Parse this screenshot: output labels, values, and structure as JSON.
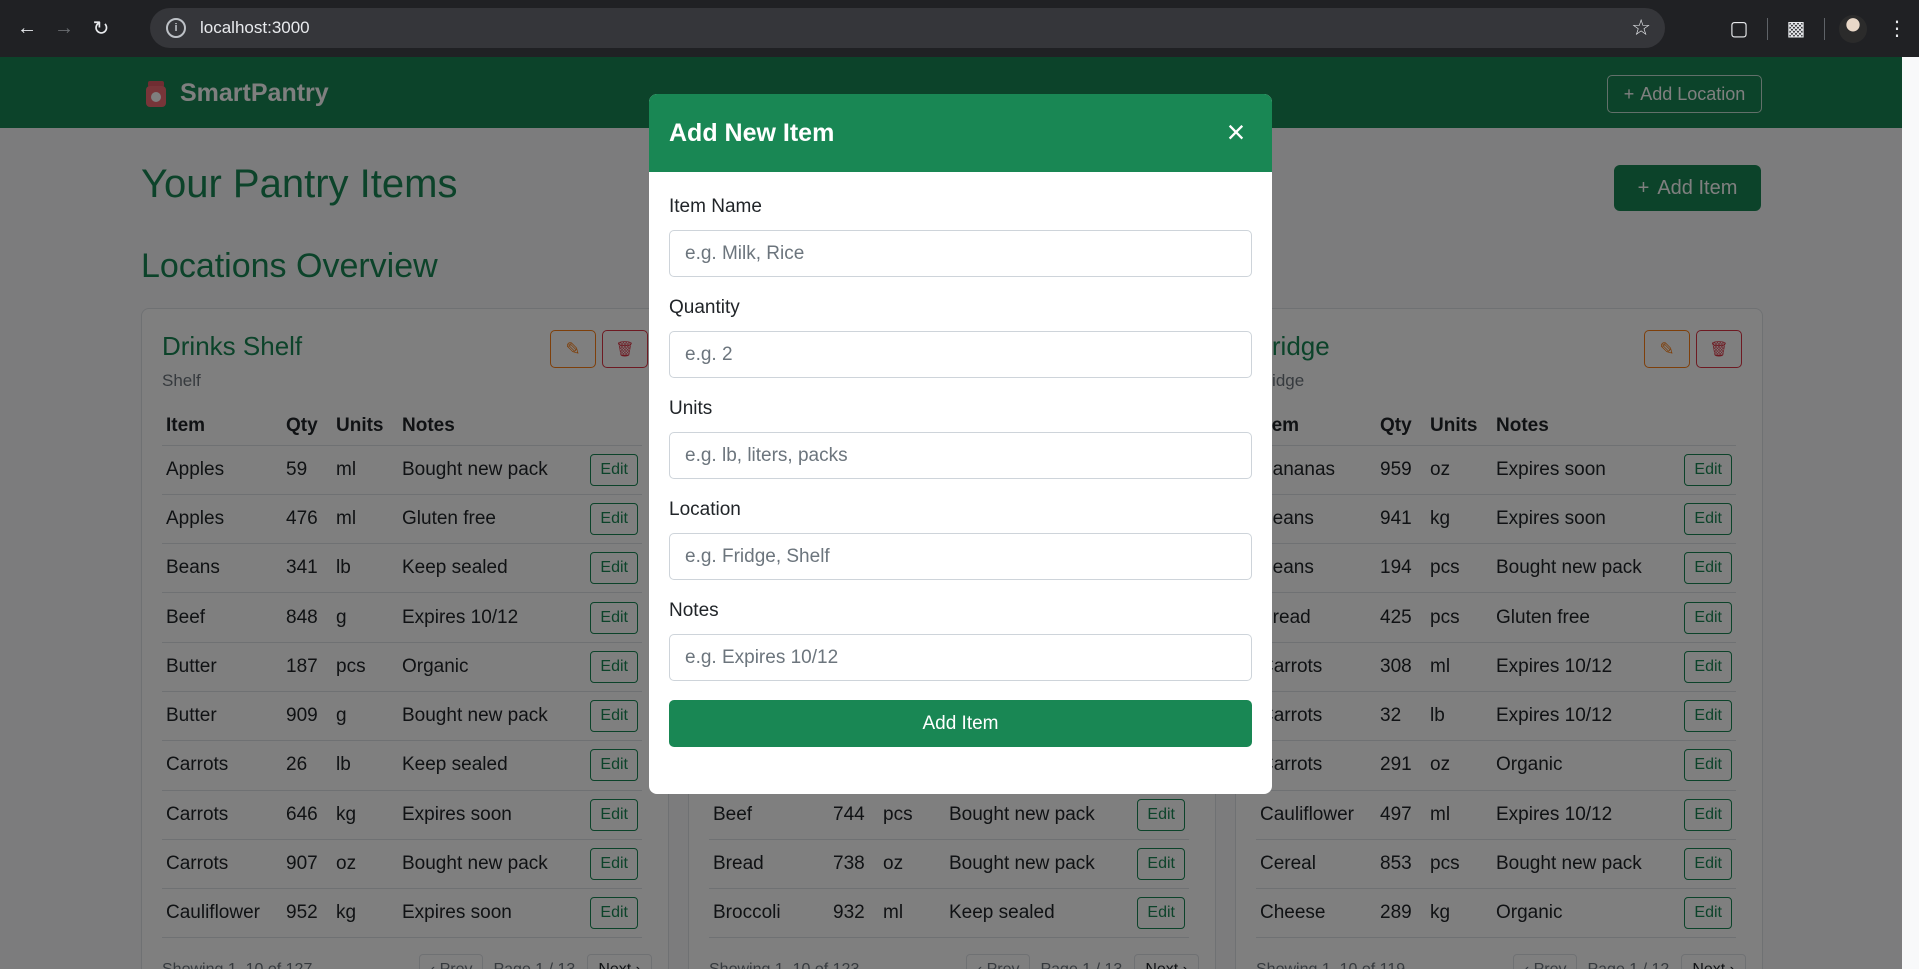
{
  "browser": {
    "url": "localhost:3000"
  },
  "navbar": {
    "brand": "SmartPantry",
    "add_location_label": "Add Location"
  },
  "main": {
    "title": "Your Pantry Items",
    "add_item_label": "Add Item",
    "locations_title": "Locations Overview"
  },
  "table_headers": [
    "Item",
    "Qty",
    "Units",
    "Notes"
  ],
  "edit_label": "Edit",
  "pager": {
    "prev": "‹ Prev",
    "next": "Next ›"
  },
  "locations": [
    {
      "name": "Drinks Shelf",
      "type": "Shelf",
      "showing": "Showing 1–10 of 127",
      "page": "Page 1 / 13",
      "rows": [
        [
          "Apples",
          "59",
          "ml",
          "Bought new pack"
        ],
        [
          "Apples",
          "476",
          "ml",
          "Gluten free"
        ],
        [
          "Beans",
          "341",
          "lb",
          "Keep sealed"
        ],
        [
          "Beef",
          "848",
          "g",
          "Expires 10/12"
        ],
        [
          "Butter",
          "187",
          "pcs",
          "Organic"
        ],
        [
          "Butter",
          "909",
          "g",
          "Bought new pack"
        ],
        [
          "Carrots",
          "26",
          "lb",
          "Keep sealed"
        ],
        [
          "Carrots",
          "646",
          "kg",
          "Expires soon"
        ],
        [
          "Carrots",
          "907",
          "oz",
          "Bought new pack"
        ],
        [
          "Cauliflower",
          "952",
          "kg",
          "Expires soon"
        ]
      ]
    },
    {
      "name": "",
      "type": "",
      "showing": "Showing 1–10 of 123",
      "page": "Page 1 / 13",
      "rows": [
        [
          "",
          "",
          "",
          ""
        ],
        [
          "",
          "",
          "",
          ""
        ],
        [
          "",
          "",
          "",
          ""
        ],
        [
          "",
          "",
          "",
          ""
        ],
        [
          "",
          "",
          "",
          ""
        ],
        [
          "",
          "",
          "",
          ""
        ],
        [
          "",
          "",
          "",
          ""
        ],
        [
          "Beef",
          "744",
          "pcs",
          "Bought new pack"
        ],
        [
          "Bread",
          "738",
          "oz",
          "Bought new pack"
        ],
        [
          "Broccoli",
          "932",
          "ml",
          "Keep sealed"
        ]
      ]
    },
    {
      "name": "Fridge",
      "type": "Fridge",
      "showing": "Showing 1–10 of 119",
      "page": "Page 1 / 12",
      "rows": [
        [
          "Bananas",
          "959",
          "oz",
          "Expires soon"
        ],
        [
          "Beans",
          "941",
          "kg",
          "Expires soon"
        ],
        [
          "Beans",
          "194",
          "pcs",
          "Bought new pack"
        ],
        [
          "Bread",
          "425",
          "pcs",
          "Gluten free"
        ],
        [
          "Carrots",
          "308",
          "ml",
          "Expires 10/12"
        ],
        [
          "Carrots",
          "32",
          "lb",
          "Expires 10/12"
        ],
        [
          "Carrots",
          "291",
          "oz",
          "Organic"
        ],
        [
          "Cauliflower",
          "497",
          "ml",
          "Expires 10/12"
        ],
        [
          "Cereal",
          "853",
          "pcs",
          "Bought new pack"
        ],
        [
          "Cheese",
          "289",
          "kg",
          "Organic"
        ]
      ]
    }
  ],
  "modal": {
    "title": "Add New Item",
    "close": "×",
    "fields": {
      "name": {
        "label": "Item Name",
        "placeholder": "e.g. Milk, Rice",
        "value": ""
      },
      "quantity": {
        "label": "Quantity",
        "placeholder": "e.g. 2",
        "value": ""
      },
      "units": {
        "label": "Units",
        "placeholder": "e.g. lb, liters, packs",
        "value": ""
      },
      "location": {
        "label": "Location",
        "placeholder": "e.g. Fridge, Shelf",
        "value": ""
      },
      "notes": {
        "label": "Notes",
        "placeholder": "e.g. Expires 10/12",
        "value": ""
      }
    },
    "submit_label": "Add Item"
  },
  "colors": {
    "primary": "#198754",
    "edit_icon": "#fd7e14",
    "delete_icon": "#dc3545"
  }
}
